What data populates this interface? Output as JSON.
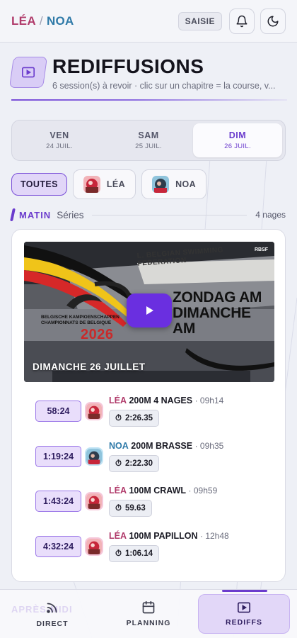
{
  "header": {
    "brand_lea": "LÉA",
    "brand_sep": "/",
    "brand_noa": "NOA",
    "saisie_label": "SAISIE",
    "bell_icon": "bell-icon",
    "theme_icon": "moon-icon"
  },
  "page": {
    "title": "REDIFFUSIONS",
    "subtitle": "6 session(s) à revoir · clic sur un chapitre = la course, v...",
    "title_icon": "play-square-icon"
  },
  "day_tabs": [
    {
      "day": "VEN",
      "date": "24 JUIL.",
      "active": false
    },
    {
      "day": "SAM",
      "date": "25 JUIL.",
      "active": false
    },
    {
      "day": "DIM",
      "date": "26 JUIL.",
      "active": true
    }
  ],
  "filters": [
    {
      "label": "TOUTES",
      "active": true
    },
    {
      "label": "LÉA",
      "active": false
    },
    {
      "label": "NOA",
      "active": false
    }
  ],
  "section": {
    "label": "MATIN",
    "sub": "Séries",
    "count": "4 nages"
  },
  "video": {
    "caption": "DIMANCHE 26 JUILLET",
    "overlay_line1": "ZONDAG AM",
    "overlay_line2": "DIMANCHE AM",
    "overlay_year": "2026",
    "overlay_left": "BELGISCHE KAMPIOENSCHAPPEN",
    "overlay_left2": "CHAMPIONNATS DE BELGIQUE",
    "overlay_banner": "L. BELGIAN SWIMMING FEDERATION",
    "overlay_logo": "RBSF",
    "play_icon": "play-icon"
  },
  "chapters": [
    {
      "time": "58:24",
      "swimmer": "LÉA",
      "who": "lea",
      "event": "200M 4 NAGES",
      "at": "· 09h14",
      "result": "2:26.35"
    },
    {
      "time": "1:19:24",
      "swimmer": "NOA",
      "who": "noa",
      "event": "200M BRASSE",
      "at": "· 09h35",
      "result": "2:22.30"
    },
    {
      "time": "1:43:24",
      "swimmer": "LÉA",
      "who": "lea",
      "event": "100M CRAWL",
      "at": "· 09h59",
      "result": "59.63"
    },
    {
      "time": "4:32:24",
      "swimmer": "LÉA",
      "who": "lea",
      "event": "100M PAPILLON",
      "at": "· 12h48",
      "result": "1:06.14"
    }
  ],
  "next_section_ghost": "APRÈS-MIDI",
  "bottom_nav": [
    {
      "label": "DIRECT",
      "icon": "broadcast-icon",
      "active": false
    },
    {
      "label": "PLANNING",
      "icon": "calendar-icon",
      "active": false
    },
    {
      "label": "REDIFFS",
      "icon": "play-square-icon",
      "active": true
    }
  ],
  "colors": {
    "accent": "#6b3ccd",
    "lea": "#b03a6a",
    "noa": "#2f7aa8"
  }
}
